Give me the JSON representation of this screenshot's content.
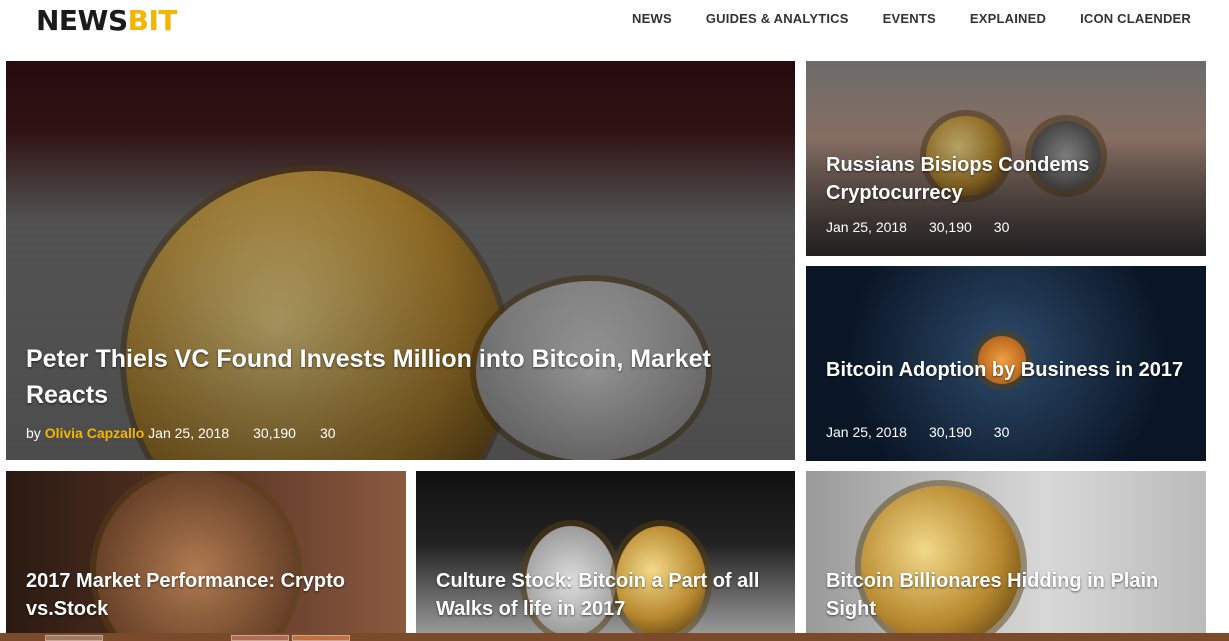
{
  "header": {
    "logo_main": "NEWS",
    "logo_accent": "BIT",
    "nav": [
      "NEWS",
      "GUIDES & ANALYTICS",
      "EVENTS",
      "EXPLAINED",
      "ICON CLAENDER"
    ]
  },
  "colors": {
    "accent": "#f4b400"
  },
  "featured": {
    "title": "Peter Thiels VC Found Invests Million into Bitcoin, Market Reacts",
    "by": "by",
    "author": "Olivia Capzallo",
    "date": "Jan 25, 2018",
    "views": "30,190",
    "comments": "30"
  },
  "side": [
    {
      "title": "Russians Bisiops Condems Cryptocurrecy",
      "date": "Jan 25, 2018",
      "views": "30,190",
      "comments": "30"
    },
    {
      "title": "Bitcoin Adoption by Business in 2017",
      "date": "Jan 25, 2018",
      "views": "30,190",
      "comments": "30"
    }
  ],
  "bottom": [
    {
      "title": "2017 Market Performance: Crypto vs.Stock"
    },
    {
      "title": "Culture Stock: Bitcoin a Part of all Walks of life in 2017"
    },
    {
      "title": "Bitcoin Billionares Hidding in Plain Sight"
    }
  ]
}
